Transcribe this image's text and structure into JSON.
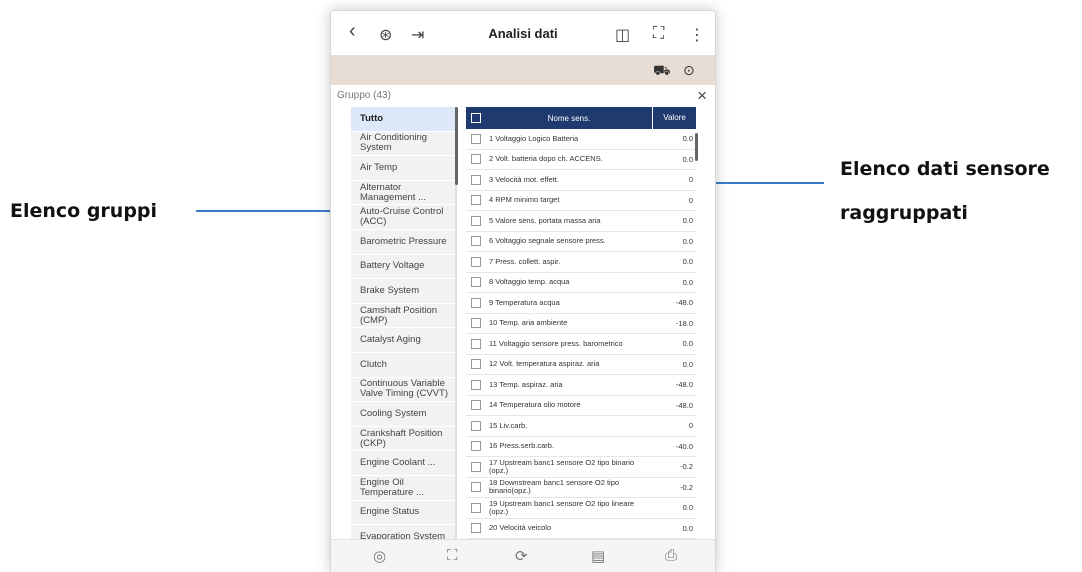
{
  "callouts": {
    "left": "Elenco gruppi",
    "right_line1": "Elenco dati sensore",
    "right_line2": "raggruppati"
  },
  "topbar": {
    "back_icon": "‹",
    "vin_icon": "⊛",
    "export_icon": "⇥",
    "title": "Analisi dati",
    "record_icon": "◫",
    "fullscreen_icon": "⛶",
    "more_icon": "⋮"
  },
  "bannerbar": {
    "vehicle_icon": "⛟",
    "settings_icon": "⊙"
  },
  "group": {
    "label": "Gruppo (43)",
    "close_icon": "×"
  },
  "sidebar": {
    "items": [
      {
        "label": "Tutto",
        "active": true
      },
      {
        "label": "Air Conditioning System"
      },
      {
        "label": "Air Temp"
      },
      {
        "label": "Alternator Management ..."
      },
      {
        "label": "Auto-Cruise Control (ACC)"
      },
      {
        "label": "Barometric Pressure"
      },
      {
        "label": "Battery Voltage"
      },
      {
        "label": "Brake System"
      },
      {
        "label": "Camshaft Position (CMP)"
      },
      {
        "label": "Catalyst Aging"
      },
      {
        "label": "Clutch"
      },
      {
        "label": "Continuous Variable Valve Timing (CVVT)"
      },
      {
        "label": "Cooling System"
      },
      {
        "label": "Crankshaft Position (CKP)"
      },
      {
        "label": "Engine Coolant ..."
      },
      {
        "label": "Engine Oil Temperature ..."
      },
      {
        "label": "Engine Status"
      },
      {
        "label": "Evaporation System"
      }
    ]
  },
  "table": {
    "header_name": "Nome sens.",
    "header_value": "Valore",
    "rows": [
      {
        "name": "1 Voltaggio Logico Batteria",
        "value": "0.0"
      },
      {
        "name": "2 Volt. batteria dopo ch. ACCENS.",
        "value": "0.0"
      },
      {
        "name": "3 Velocità mot. effett.",
        "value": "0"
      },
      {
        "name": "4 RPM minimo target",
        "value": "0"
      },
      {
        "name": "5 Valore sens. portata massa aria",
        "value": "0.0"
      },
      {
        "name": "6 Voltaggio segnale sensore press.",
        "value": "0.0"
      },
      {
        "name": "7 Press. collett. aspir.",
        "value": "0.0"
      },
      {
        "name": "8 Voltaggio temp. acqua",
        "value": "0.0"
      },
      {
        "name": "9 Temperatura acqua",
        "value": "-48.0"
      },
      {
        "name": "10 Temp. aria ambiente",
        "value": "-18.0"
      },
      {
        "name": "11 Voltaggio sensore press. barometrico",
        "value": "0.0"
      },
      {
        "name": "12 Volt. temperatura aspiraz. aria",
        "value": "0.0"
      },
      {
        "name": "13 Temp. aspiraz. aria",
        "value": "-48.0"
      },
      {
        "name": "14 Temperatura olio motore",
        "value": "-48.0"
      },
      {
        "name": "15 Liv.carb.",
        "value": "0"
      },
      {
        "name": "16 Press.serb.carb.",
        "value": "-40.0"
      },
      {
        "name": "17 Upstream banc1 sensore O2 tipo binario (opz.)",
        "value": "-0.2"
      },
      {
        "name": "18 Downstream banc1 sensore O2 tipo binario(opz.)",
        "value": "-0.2"
      },
      {
        "name": "19 Upstream banc1 sensore O2 tipo lineare (opz.)",
        "value": "0.0"
      },
      {
        "name": "20 Velocità veicolo",
        "value": "0.0"
      }
    ]
  },
  "bottombar": {
    "record_icon": "◎",
    "expand_icon": "⛶",
    "refresh_icon": "⟳",
    "report_icon": "▤",
    "save_icon": "⎙"
  }
}
